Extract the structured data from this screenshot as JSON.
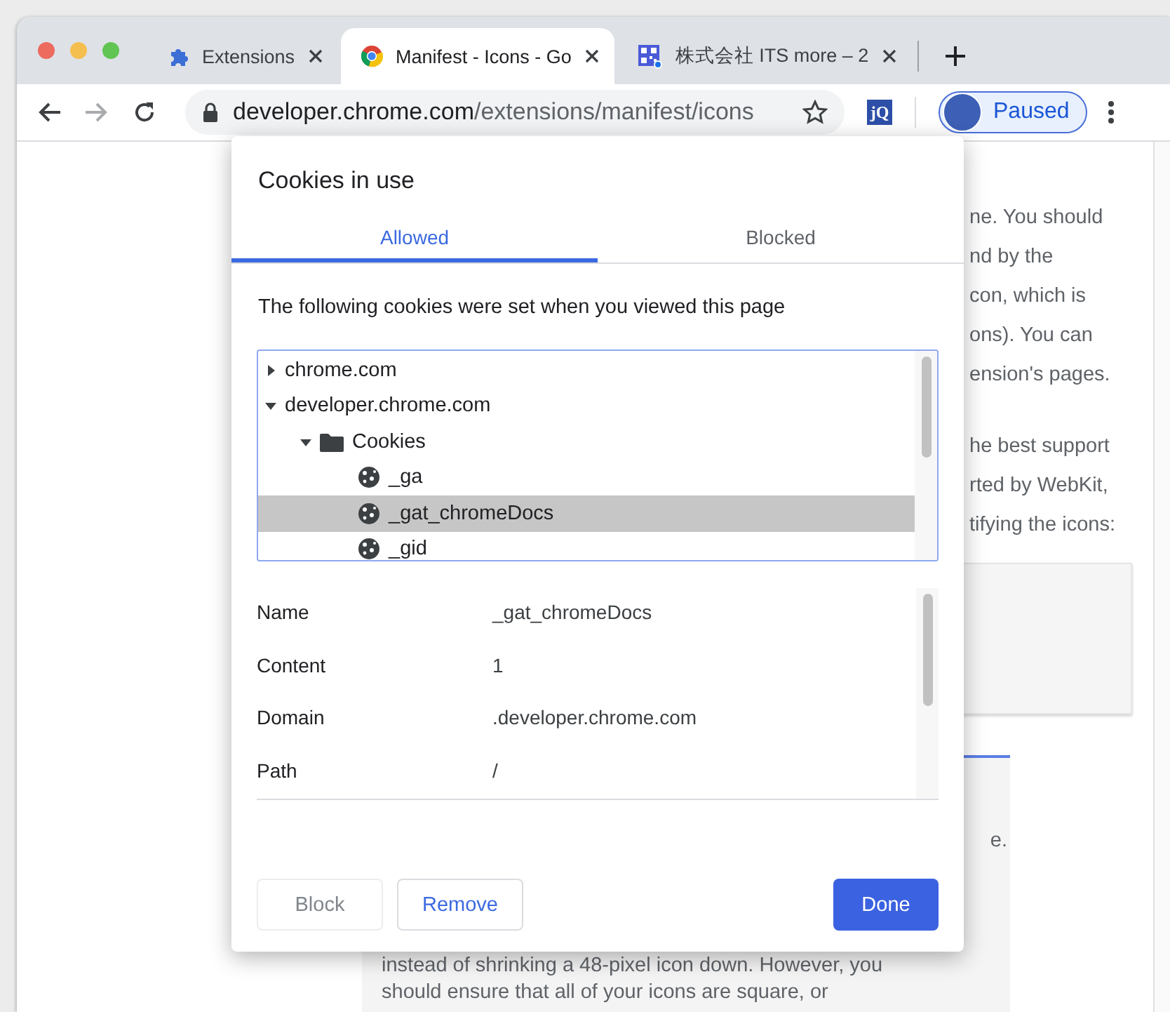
{
  "window": {
    "traffic_lights": [
      {
        "color": "#ed6a5e"
      },
      {
        "color": "#f5bf4f"
      },
      {
        "color": "#61c554"
      }
    ]
  },
  "tabs": [
    {
      "title": "Extensions",
      "kind": "puzzle",
      "selected": false
    },
    {
      "title": "Manifest - Icons - Go",
      "kind": "chrome",
      "selected": true
    },
    {
      "title": "株式会社 ITS more – 2",
      "kind": "qr",
      "selected": false
    }
  ],
  "toolbar": {
    "forward_disabled": true,
    "url_host": "developer.chrome.com",
    "url_path": "/extensions/manifest/icons",
    "extension_label": "jQ",
    "profile_status": "Paused"
  },
  "page": {
    "text_fragments": [
      "ne. You should",
      "nd by the",
      "con, which is",
      "ons). You can",
      "ension's pages.",
      "he best support",
      "rted by WebKit,",
      "tifying the icons:"
    ],
    "article_lines": [
      "e.",
      "instead of shrinking a 48-pixel icon down. However, you",
      "should ensure that all of your icons are square, or"
    ]
  },
  "dialog": {
    "title": "Cookies in use",
    "tabs": [
      {
        "label": "Allowed",
        "selected": true
      },
      {
        "label": "Blocked",
        "selected": false
      }
    ],
    "description": "The following cookies were set when you viewed this page",
    "tree": [
      {
        "label": "chrome.com",
        "expanded": false,
        "selected": false
      },
      {
        "label": "developer.chrome.com",
        "expanded": true,
        "selected": false,
        "children": [
          {
            "label": "Cookies",
            "kind": "folder",
            "expanded": true,
            "selected": false,
            "children": [
              {
                "label": "_ga",
                "kind": "cookie",
                "selected": false
              },
              {
                "label": "_gat_chromeDocs",
                "kind": "cookie",
                "selected": true
              },
              {
                "label": "_gid",
                "kind": "cookie",
                "selected": false
              }
            ]
          }
        ]
      }
    ],
    "details": [
      {
        "label": "Name",
        "value": "_gat_chromeDocs"
      },
      {
        "label": "Content",
        "value": "1"
      },
      {
        "label": "Domain",
        "value": ".developer.chrome.com"
      },
      {
        "label": "Path",
        "value": "/"
      }
    ],
    "buttons": [
      {
        "label": "Block",
        "kind": "secondary",
        "disabled": true
      },
      {
        "label": "Remove",
        "kind": "secondary",
        "disabled": false
      },
      {
        "label": "Done",
        "kind": "primary",
        "disabled": false
      }
    ]
  }
}
